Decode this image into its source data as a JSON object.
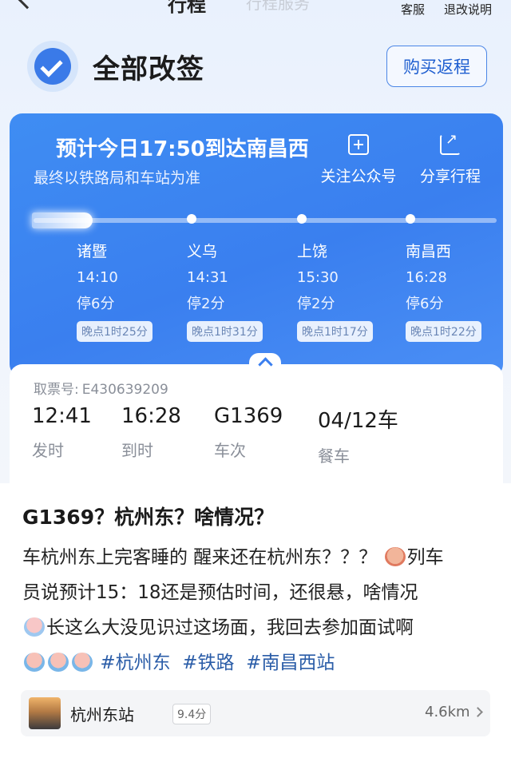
{
  "topbar": {
    "title_cut": "行程",
    "subtitle_cut": "行程服务",
    "kefu": "客服",
    "refund": "退改说明"
  },
  "status": {
    "title": "全部改签",
    "return_button": "购买返程"
  },
  "card": {
    "arrive_title": "预计今日17:50到达南昌西",
    "arrive_note": "最终以铁路局和车站为准",
    "follow_label": "关注公众号",
    "share_label": "分享行程",
    "stations": [
      {
        "name": "诸暨",
        "time": "14:10",
        "stop": "停6分",
        "late": "晚点1时25分"
      },
      {
        "name": "义乌",
        "time": "14:31",
        "stop": "停2分",
        "late": "晚点1时31分"
      },
      {
        "name": "上饶",
        "time": "15:30",
        "stop": "停2分",
        "late": "晚点1时17分"
      },
      {
        "name": "南昌西",
        "time": "16:28",
        "stop": "停6分",
        "late": "晚点1时22分"
      }
    ]
  },
  "ticket": {
    "number_label": "取票号:",
    "number": "E430639209",
    "fields": [
      {
        "value": "12:41",
        "label": "发时"
      },
      {
        "value": "16:28",
        "label": "到时"
      },
      {
        "value": "G1369",
        "label": "车次"
      },
      {
        "value": "04/12车",
        "label": "餐车"
      }
    ]
  },
  "post": {
    "title": "G1369？杭州东？啥情况？",
    "line1": "车杭州东上完客睡的 醒来还在杭州东？？？",
    "line1b": "列车",
    "line2": "员说预计15：18还是预估时间，还很悬，啥情况",
    "line3": "长这么大没见识过这场面，我回去参加面试啊",
    "tags": [
      "#杭州东",
      "#铁路",
      "#南昌西站"
    ]
  },
  "location": {
    "name": "杭州东站",
    "score": "9.4分",
    "distance": "4.6km"
  },
  "icons": {
    "check": "check-circle-icon",
    "follow": "plus-square-icon",
    "share": "share-icon"
  },
  "colors": {
    "accent": "#3a7fef",
    "hashtag": "#2b5da8"
  }
}
